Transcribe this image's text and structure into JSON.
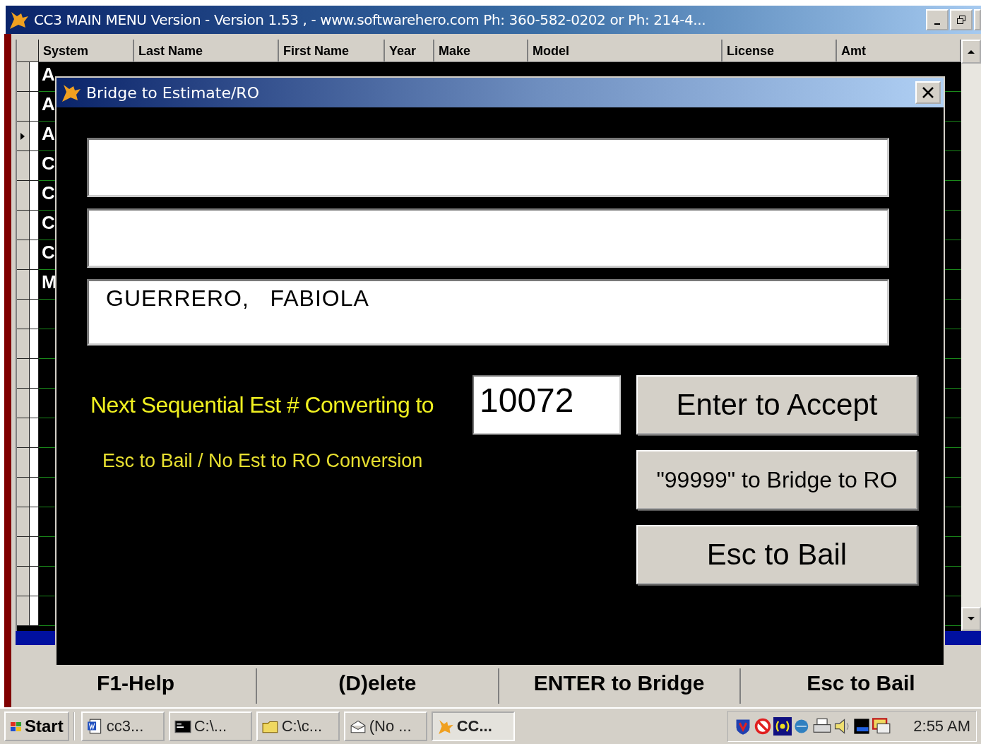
{
  "window": {
    "title": "CC3 MAIN MENU Version - Version 1.53 , - www.softwarehero.com  Ph: 360-582-0202 or Ph: 214-4..."
  },
  "table": {
    "columns": [
      "System",
      "Last Name",
      "First Name",
      "Year",
      "Make",
      "Model",
      "License",
      "Amt"
    ],
    "rows": [
      {
        "system": "A",
        "current": false
      },
      {
        "system": "A",
        "current": false
      },
      {
        "system": "A",
        "current": true
      },
      {
        "system": "C",
        "current": false
      },
      {
        "system": "C",
        "current": false
      },
      {
        "system": "C",
        "current": false
      },
      {
        "system": "C",
        "current": false
      },
      {
        "system": "M",
        "current": false
      }
    ]
  },
  "dialog": {
    "title": "Bridge to Estimate/RO",
    "fields": [
      {
        "kind": "blank"
      },
      {
        "kind": "blank"
      },
      {
        "kind": "text",
        "value": "GUERRERO,   FABIOLA"
      }
    ],
    "prompt": "Next Sequential Est # Converting to",
    "number": "10072",
    "hint": "Esc to Bail / No Est to RO Conversion",
    "buttons": [
      {
        "label": "Enter to Accept"
      },
      {
        "label": "\"99999\" to Bridge to RO"
      },
      {
        "label": "Esc to Bail"
      }
    ]
  },
  "function_keys": [
    "F1-Help",
    "(D)elete",
    "ENTER to Bridge",
    "Esc to Bail"
  ],
  "taskbar": {
    "start": "Start",
    "tasks": [
      {
        "label": "cc3...",
        "kind": "word",
        "selected": false
      },
      {
        "label": "C:\\...",
        "kind": "console",
        "selected": false
      },
      {
        "label": "C:\\c...",
        "kind": "folder",
        "selected": false
      },
      {
        "label": "(No ...",
        "kind": "mail",
        "selected": false
      },
      {
        "label": "CC...",
        "kind": "fox",
        "selected": true
      }
    ],
    "clock": "2:55 AM"
  }
}
